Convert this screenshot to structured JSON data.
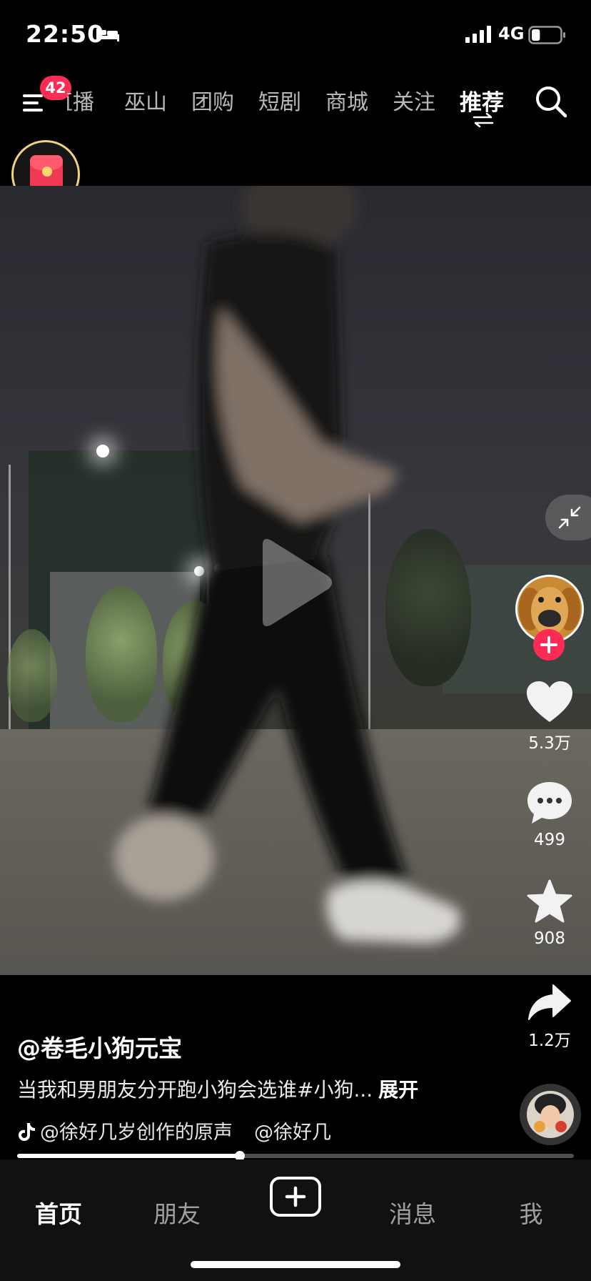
{
  "status_bar": {
    "time": "22:50",
    "network": "4G",
    "battery_level": 0.3
  },
  "top_nav": {
    "badge_count": "42",
    "tabs": [
      "直播",
      "巫山",
      "团购",
      "短剧",
      "商城",
      "关注",
      "推荐"
    ],
    "active_tab": "推荐"
  },
  "video": {
    "paused": true
  },
  "side_rail": {
    "like_count": "5.3万",
    "comment_count": "499",
    "favorite_count": "908",
    "share_count": "1.2万"
  },
  "caption": {
    "author": "@卷毛小狗元宝",
    "description": "当我和男朋友分开跑小狗会选谁#小狗...",
    "expand": "展开",
    "music_1": "@徐好几岁创作的原声",
    "music_2": "@徐好几"
  },
  "progress": {
    "fraction": 0.4
  },
  "bottom_nav": {
    "home": "首页",
    "friends": "朋友",
    "messages": "消息",
    "me": "我"
  },
  "colors": {
    "accent": "#fe2c55",
    "envelope_ring": "#f2d27d"
  }
}
